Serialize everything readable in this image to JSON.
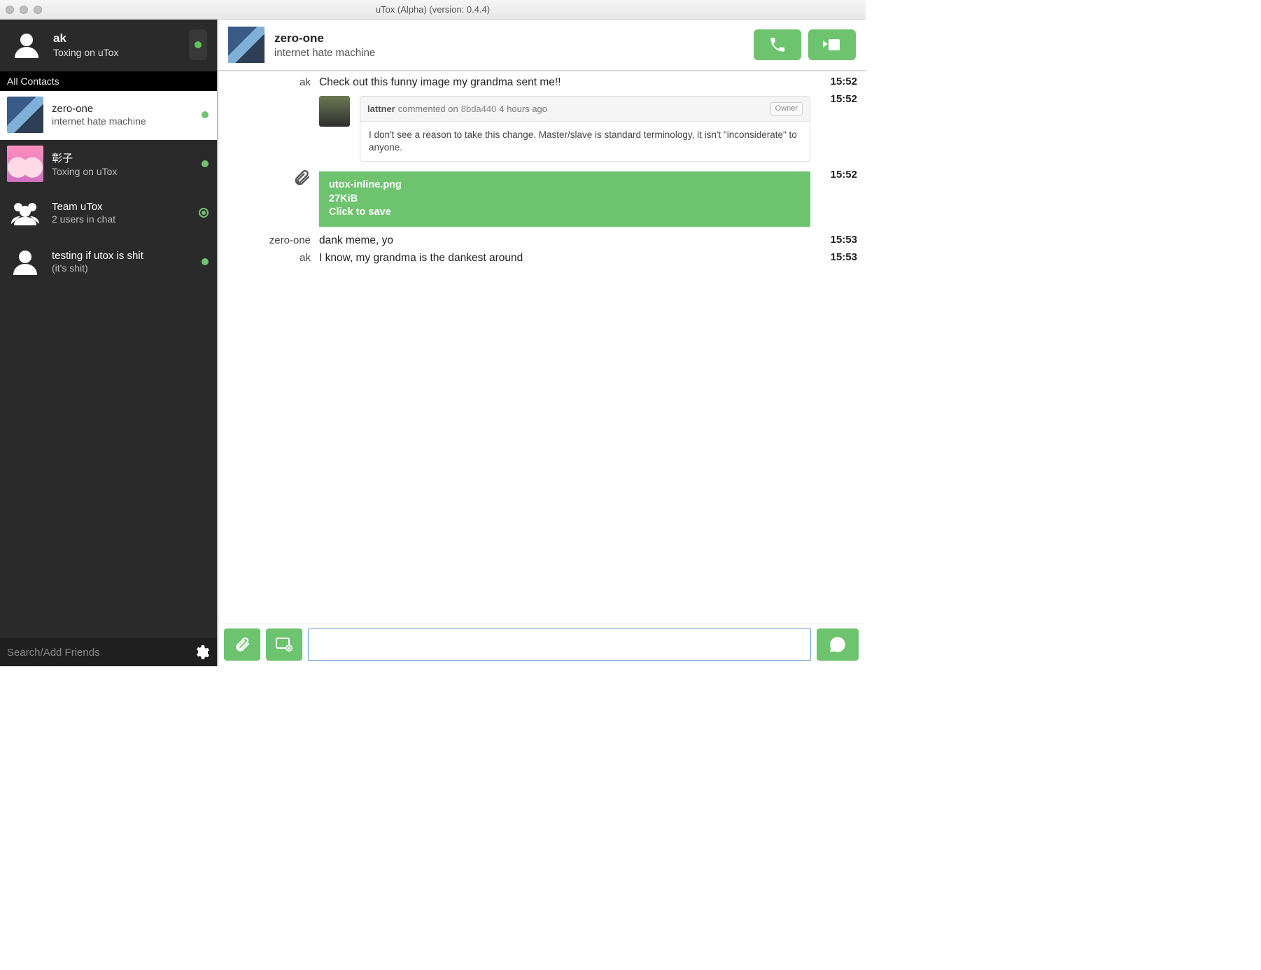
{
  "window": {
    "title": "uTox (Alpha) (version: 0.4.4)"
  },
  "self": {
    "name": "ak",
    "status": "Toxing on uTox"
  },
  "section_header": "All Contacts",
  "contacts": [
    {
      "name": "zero-one",
      "status": "internet hate machine"
    },
    {
      "name": "彰子",
      "status": "Toxing on uTox"
    },
    {
      "name": "Team uTox",
      "status": "2 users in chat"
    },
    {
      "name": "testing if utox is shit",
      "status": "(it's shit)"
    }
  ],
  "search": {
    "placeholder": "Search/Add Friends"
  },
  "chat_header": {
    "name": "zero-one",
    "status": "internet hate machine"
  },
  "messages": {
    "m0": {
      "sender": "ak",
      "text": "Check out this funny image my grandma sent me!!",
      "time": "15:52"
    },
    "m1_embed": {
      "time": "15:52",
      "author": "lattner",
      "verb": "commented on",
      "ref": "8bda440",
      "when": "4 hours ago",
      "badge": "Owner",
      "body": "I don't see a reason to take this change. Master/slave is standard terminology, it isn't \"inconsiderate\" to anyone."
    },
    "m2_file": {
      "time": "15:52",
      "filename": "utox-inline.png",
      "filesize": "27KiB",
      "hint": "Click to save"
    },
    "m3": {
      "sender": "zero-one",
      "text": "dank meme, yo",
      "time": "15:53"
    },
    "m4": {
      "sender": "ak",
      "text": "I know, my grandma is the dankest around",
      "time": "15:53"
    }
  },
  "input": {
    "value": ""
  }
}
